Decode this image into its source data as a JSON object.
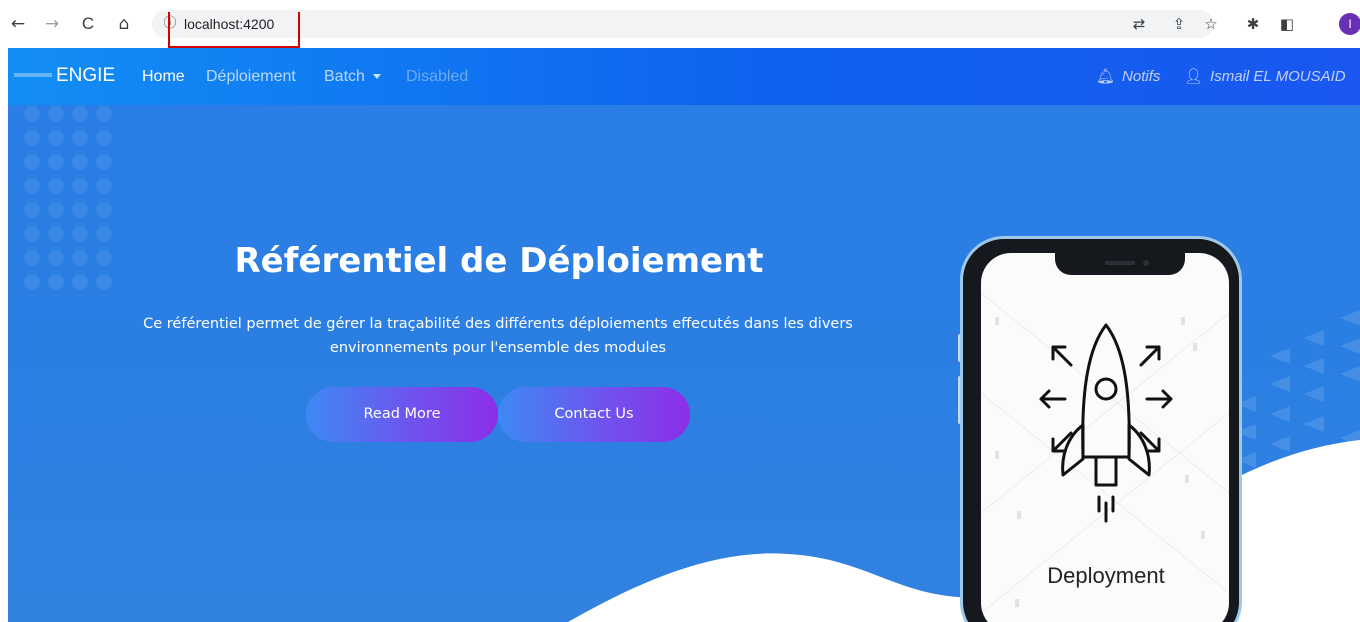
{
  "browser": {
    "url": "localhost:4200",
    "info_glyph": "ⓘ",
    "back_glyph": "←",
    "forward_glyph": "→",
    "reload_glyph": "C",
    "home_glyph": "⌂",
    "toolbar_glyphs": {
      "translate": "⇄",
      "share": "⇪",
      "bookmark": "☆",
      "extensions": "✱",
      "sidebar": "◧"
    },
    "profile_initial": "I"
  },
  "navbar": {
    "brand": "ENGIE",
    "links": [
      {
        "label": "Home",
        "state": "active"
      },
      {
        "label": "Déploiement",
        "state": "normal"
      },
      {
        "label": "Batch",
        "state": "dropdown"
      },
      {
        "label": "Disabled",
        "state": "disabled"
      }
    ],
    "notifs_label": "Notifs",
    "bell_glyph": "♫",
    "user_label": "Ismail EL MOUSAID",
    "user_glyph": "⚇"
  },
  "hero": {
    "title": "Référentiel de Déploiement",
    "description_line1": "Ce référentiel permet de gérer la traçabilité des différents déploiements effecutés dans les divers",
    "description_line2": "environnements pour l'ensemble des modules",
    "read_more_label": "Read More",
    "contact_label": "Contact Us"
  },
  "phone": {
    "caption": "Deployment"
  },
  "colors": {
    "navbar_start": "#138ef5",
    "navbar_end": "#1a57f0",
    "hero_bg": "#2b7fe3",
    "button_start": "#3d8af4",
    "button_end": "#8c2ee8",
    "url_highlight": "#d40000",
    "profile": "#6b2fb3"
  }
}
